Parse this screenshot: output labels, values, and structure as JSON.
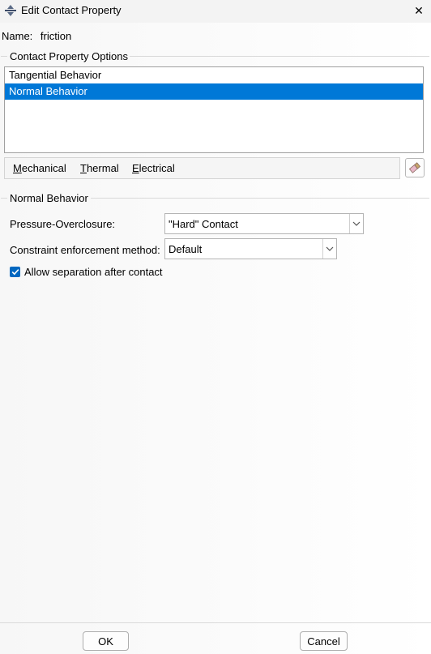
{
  "window": {
    "title": "Edit Contact Property",
    "close_symbol": "✕"
  },
  "name": {
    "label": "Name:",
    "value": "friction"
  },
  "options_group": {
    "title": "Contact Property Options",
    "items": [
      {
        "label": "Tangential Behavior",
        "selected": false
      },
      {
        "label": "Normal Behavior",
        "selected": true
      }
    ]
  },
  "menu": {
    "items": [
      {
        "mnemonic": "M",
        "rest": "echanical"
      },
      {
        "mnemonic": "T",
        "rest": "hermal"
      },
      {
        "mnemonic": "E",
        "rest": "lectrical"
      }
    ],
    "eraser_icon": "eraser-icon"
  },
  "behavior": {
    "title": "Normal Behavior",
    "pressure_overclosure": {
      "label": "Pressure-Overclosure:",
      "value": "\"Hard\" Contact"
    },
    "constraint_method": {
      "label": "Constraint enforcement method:",
      "value": "Default"
    },
    "allow_separation": {
      "label": "Allow separation after contact",
      "checked": true
    }
  },
  "buttons": {
    "ok": "OK",
    "cancel": "Cancel"
  },
  "colors": {
    "selection": "#0078d7",
    "checkbox": "#0067c0"
  }
}
